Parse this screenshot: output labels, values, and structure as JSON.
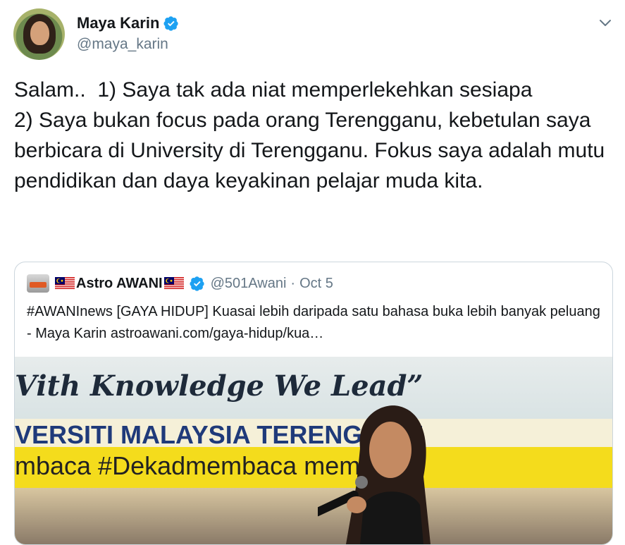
{
  "author": {
    "name": "Maya Karin",
    "handle": "@maya_karin"
  },
  "tweet": {
    "text": "Salam..  1) Saya tak ada niat memperlekehkan sesiapa\n2) Saya bukan focus pada orang Terengganu, kebetulan saya berbicara di University di Terengganu. Fokus saya adalah mutu pendidikan dan daya keyakinan pelajar muda kita."
  },
  "quoted": {
    "name": "Astro AWANI",
    "handle": "@501Awani",
    "separator": "·",
    "date": "Oct 5",
    "text": "#AWANInews [GAYA HIDUP] Kuasai lebih daripada satu bahasa buka lebih banyak peluang - Maya Karin astroawani.com/gaya-hidup/kua…",
    "image_banner": {
      "line1": "Vith Knowledge We Lead”",
      "line2": "VERSITI MALAYSIA TERENG    ANU",
      "line3": "mbaca  #Dekadmembaca        membaca"
    }
  },
  "colors": {
    "verified": "#1da1f2",
    "secondary_text": "#657786",
    "border": "#ccd6dd"
  },
  "icons": {
    "verified": "verified-badge-icon",
    "menu": "chevron-down-icon"
  }
}
